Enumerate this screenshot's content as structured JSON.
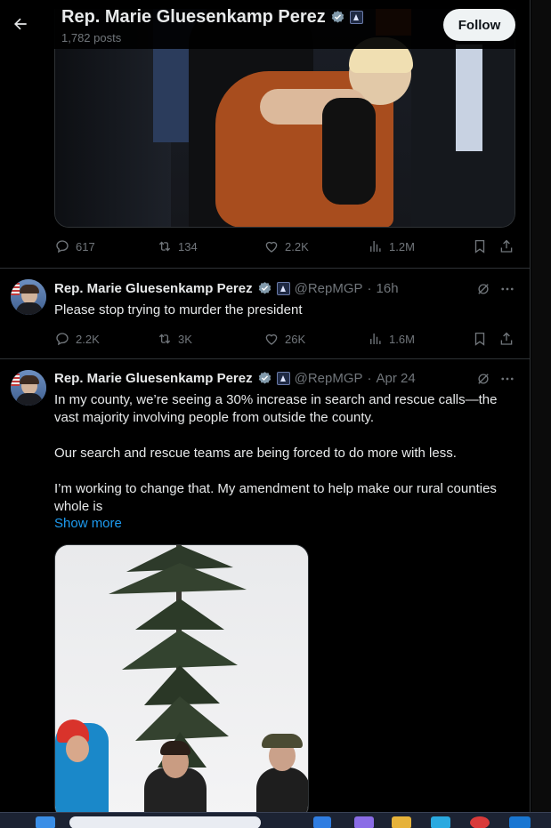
{
  "header": {
    "display_name": "Rep. Marie Gluesenkamp Perez",
    "post_count": "1,782 posts",
    "follow_label": "Follow"
  },
  "first_post_actions": {
    "replies": "617",
    "reposts": "134",
    "likes": "2.2K",
    "views": "1.2M"
  },
  "tweets": [
    {
      "display_name": "Rep. Marie Gluesenkamp Perez",
      "handle": "@RepMGP",
      "time": "16h",
      "text": "Please stop trying to murder the president",
      "replies": "2.2K",
      "reposts": "3K",
      "likes": "26K",
      "views": "1.6M"
    },
    {
      "display_name": "Rep. Marie Gluesenkamp Perez",
      "handle": "@RepMGP",
      "time": "Apr 24",
      "text_lines": [
        "In my county, we’re seeing a 30% increase in search and rescue calls—the",
        "vast majority involving people from outside the county.",
        "Our search and rescue teams are being forced to do more with less.",
        "I’m working to change that. My amendment to help make our rural counties",
        "whole is"
      ],
      "show_more": "Show more"
    }
  ],
  "colors": {
    "background": "#000000",
    "text": "#e7e9ea",
    "muted": "#71767b",
    "link": "#1d9bf0",
    "divider": "#2f3336"
  },
  "icons": [
    "back-arrow-icon",
    "verified-badge-icon",
    "government-badge-icon",
    "reply-icon",
    "repost-icon",
    "like-icon",
    "views-icon",
    "bookmark-icon",
    "share-icon",
    "grok-icon",
    "more-icon"
  ]
}
